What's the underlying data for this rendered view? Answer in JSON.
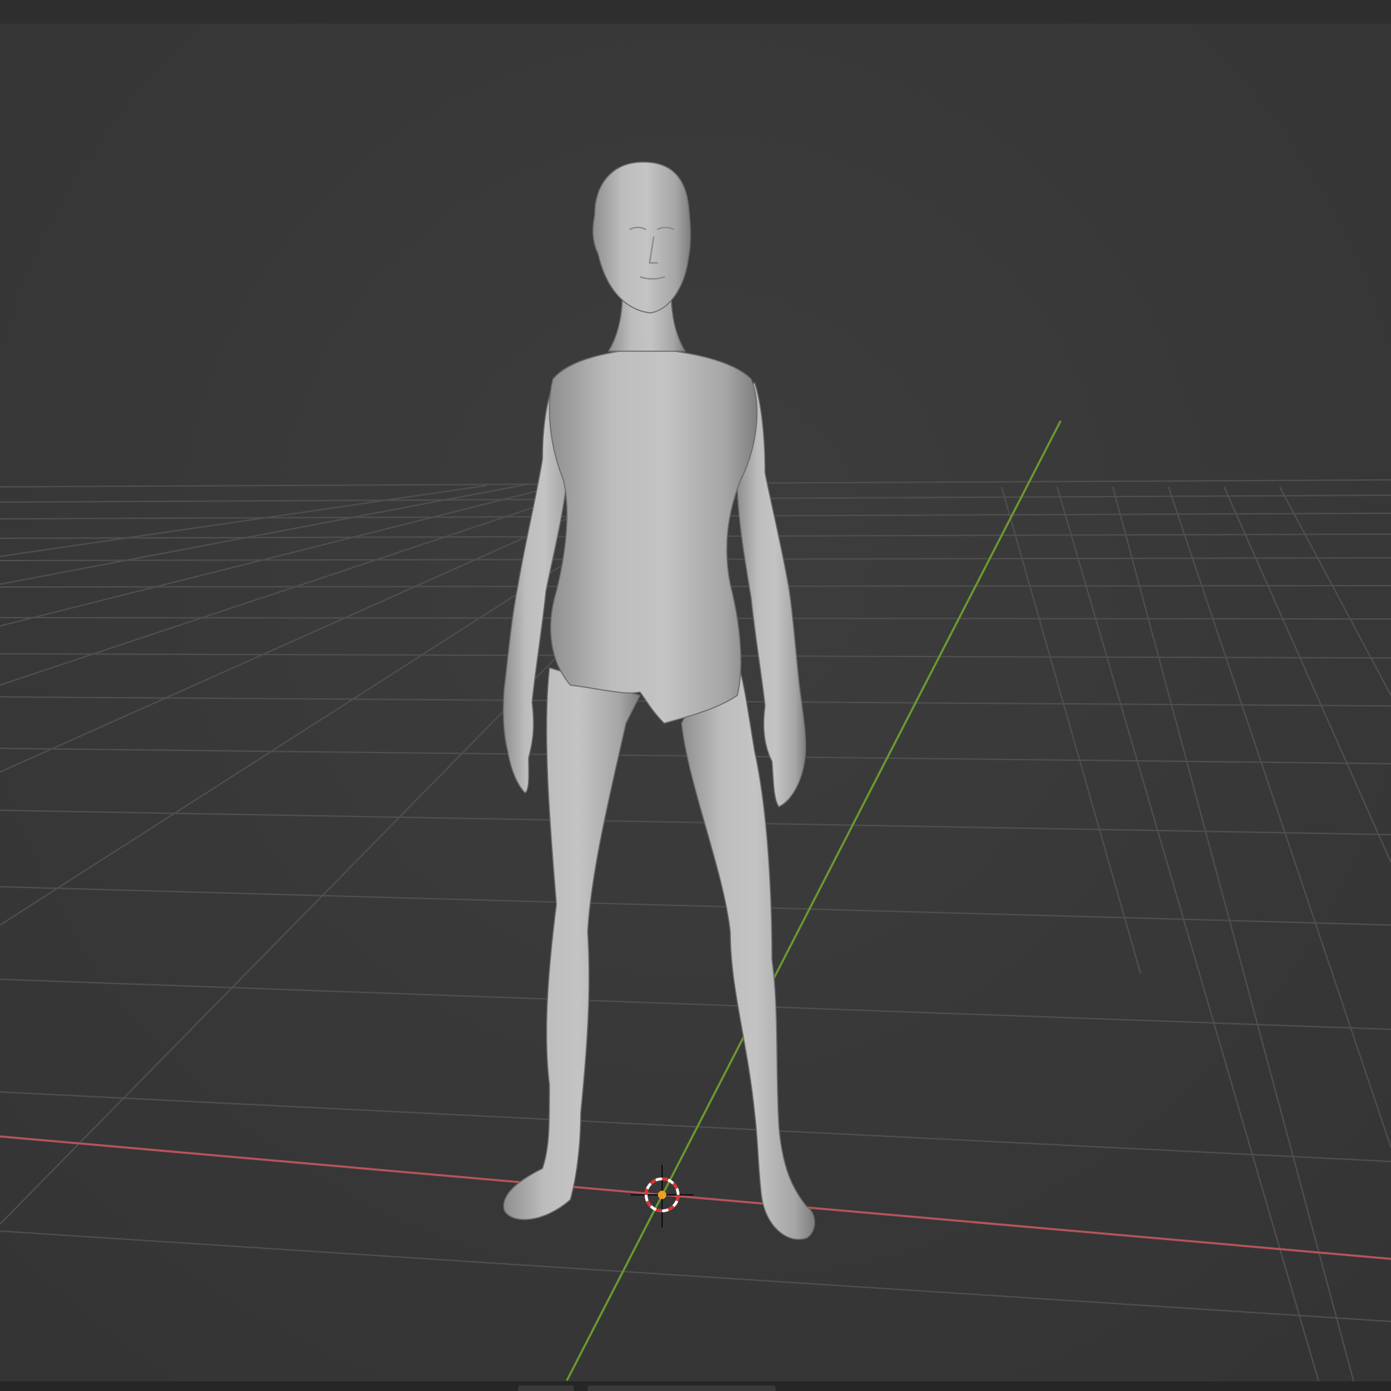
{
  "viewport": {
    "background": "#393939",
    "grid_color": "#4f4f4f",
    "x_axis_color": "#b8545a",
    "y_axis_color": "#6b9a2e",
    "object": "human-figure-mesh",
    "mesh_color": "#b8b8b8",
    "origin_marker": {
      "ring_colors": [
        "#e03030",
        "#ffffff"
      ],
      "dot_color": "#f0a020"
    }
  }
}
